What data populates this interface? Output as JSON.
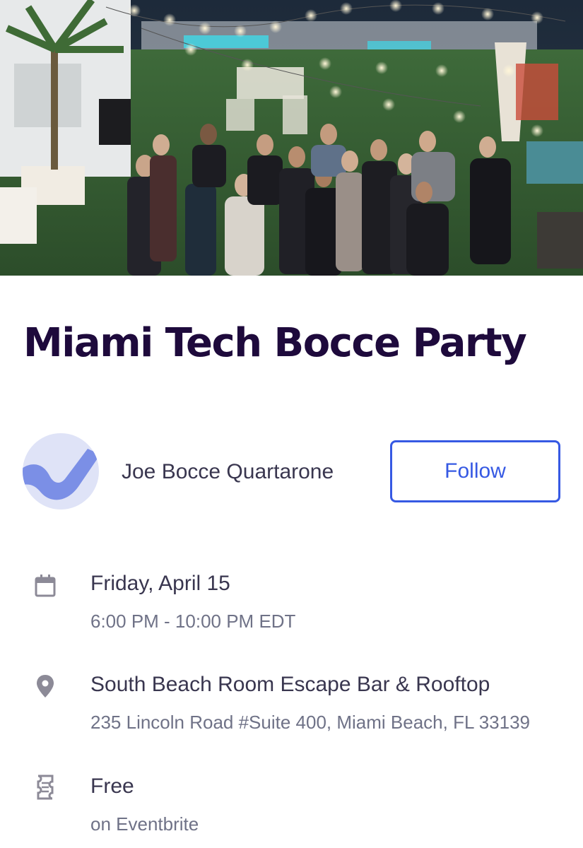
{
  "event": {
    "title": "Miami Tech Bocce Party",
    "hero_image_icon": "event-photo"
  },
  "organizer": {
    "name": "Joe Bocce Quartarone",
    "follow_label": "Follow",
    "avatar_icon": "organizer-logo"
  },
  "details": {
    "date": {
      "icon": "calendar-icon",
      "primary": "Friday, April 15",
      "secondary": "6:00 PM - 10:00 PM EDT"
    },
    "location": {
      "icon": "location-pin-icon",
      "primary": "South Beach Room Escape Bar & Rooftop",
      "secondary": "235 Lincoln Road #Suite 400, Miami Beach, FL 33139"
    },
    "price": {
      "icon": "ticket-icon",
      "primary": "Free",
      "secondary": "on Eventbrite"
    }
  },
  "colors": {
    "title": "#1e0a3c",
    "accent": "#3659e3",
    "text_primary": "#39364f",
    "text_secondary": "#6f7287",
    "icon": "#8c8a97"
  }
}
